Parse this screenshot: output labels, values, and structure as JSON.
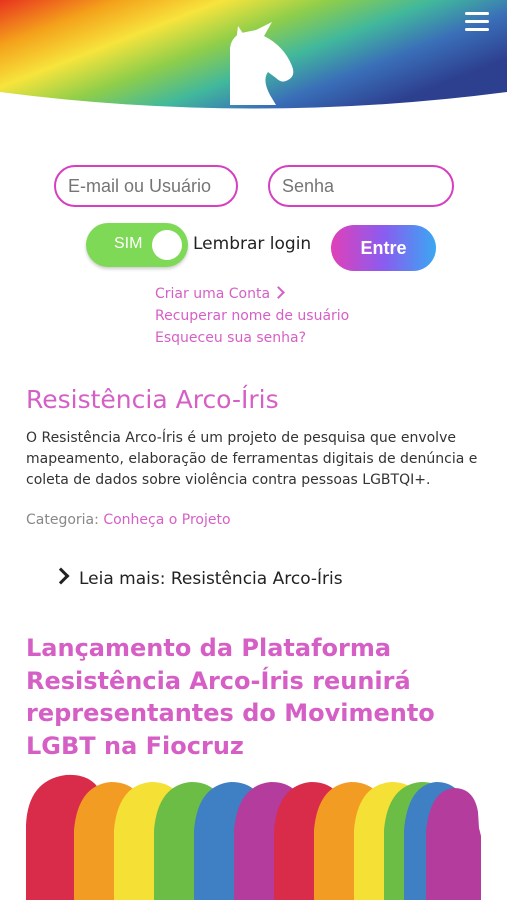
{
  "header": {
    "menu_icon": "hamburger-icon",
    "logo_icon": "unicorn-icon"
  },
  "login": {
    "email_placeholder": "E-mail ou Usuário",
    "password_placeholder": "Senha",
    "toggle_label": "SIM",
    "remember_label": "Lembrar login",
    "submit_label": "Entre",
    "links": {
      "create_account": "Criar uma Conta",
      "recover_username": "Recuperar nome de usuário",
      "forgot_password": "Esqueceu sua senha?"
    }
  },
  "articles": [
    {
      "title": "Resistência Arco-Íris",
      "body": "O Resistência Arco-Íris é um projeto de pesquisa que envolve mapeamento, elaboração de ferramentas digitais de denúncia e coleta de dados sobre violência contra pessoas LGBTQI+.",
      "category_label": "Categoria:",
      "category_value": "Conheça o Projeto",
      "read_more": "Leia mais: Resistência Arco-Íris"
    },
    {
      "title": "Lançamento da Plataforma Resistência Arco-Íris reunirá representantes do Movimento LGBT na Fiocruz"
    }
  ],
  "colors": {
    "accent": "#d65fc6",
    "toggle_on": "#7ed957",
    "border": "#d63fbf"
  }
}
